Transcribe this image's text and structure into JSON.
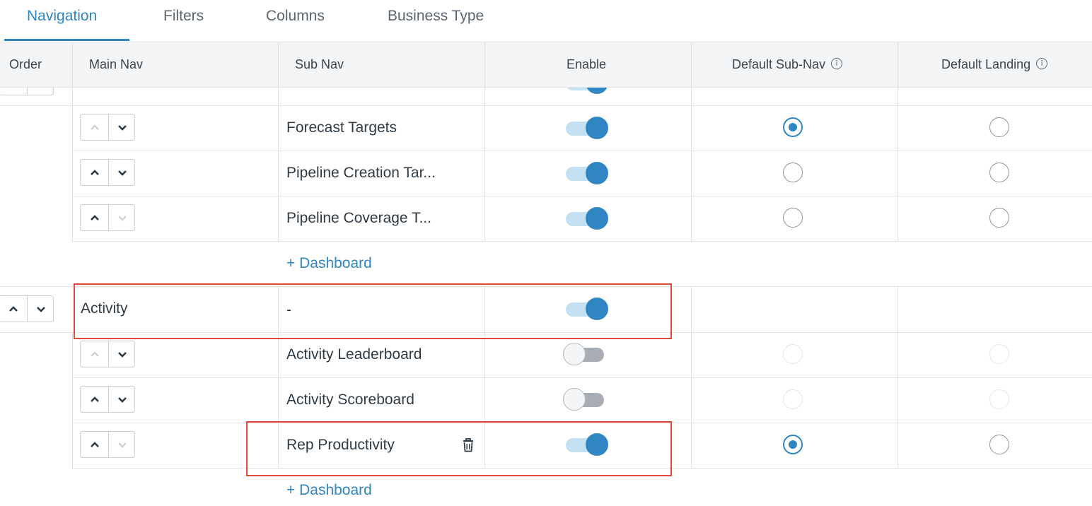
{
  "tabs": [
    {
      "label": "Navigation",
      "active": true
    },
    {
      "label": "Filters",
      "active": false
    },
    {
      "label": "Columns",
      "active": false
    },
    {
      "label": "Business Type",
      "active": false
    }
  ],
  "columns": {
    "order": "Order",
    "main_nav": "Main Nav",
    "sub_nav": "Sub Nav",
    "enable": "Enable",
    "default_sub_nav": "Default Sub-Nav",
    "default_landing": "Default Landing",
    "info_glyph": "i"
  },
  "rows": {
    "forecast_targets": {
      "sub_nav": "Forecast Targets",
      "enabled": true,
      "default_sub_nav": true
    },
    "pipeline_creation": {
      "sub_nav": "Pipeline Creation Tar...",
      "enabled": true
    },
    "pipeline_coverage": {
      "sub_nav": "Pipeline Coverage T...",
      "enabled": true
    },
    "add_dashboard_1": "+ Dashboard",
    "activity": {
      "main_nav": "Activity",
      "sub_nav": "-",
      "enabled": true
    },
    "activity_leaderboard": {
      "sub_nav": "Activity Leaderboard",
      "enabled": false
    },
    "activity_scoreboard": {
      "sub_nav": "Activity Scoreboard",
      "enabled": false
    },
    "rep_productivity": {
      "sub_nav": "Rep Productivity",
      "enabled": true,
      "default_sub_nav": true
    },
    "add_dashboard_2": "+ Dashboard"
  },
  "icons": {
    "info": "info-circle-icon",
    "up": "chevron-up-icon",
    "down": "chevron-down-icon",
    "trash": "trash-icon"
  },
  "colors": {
    "accent": "#2f86c2",
    "highlight": "#e04a3c",
    "header_bg": "#f3f5f6"
  }
}
